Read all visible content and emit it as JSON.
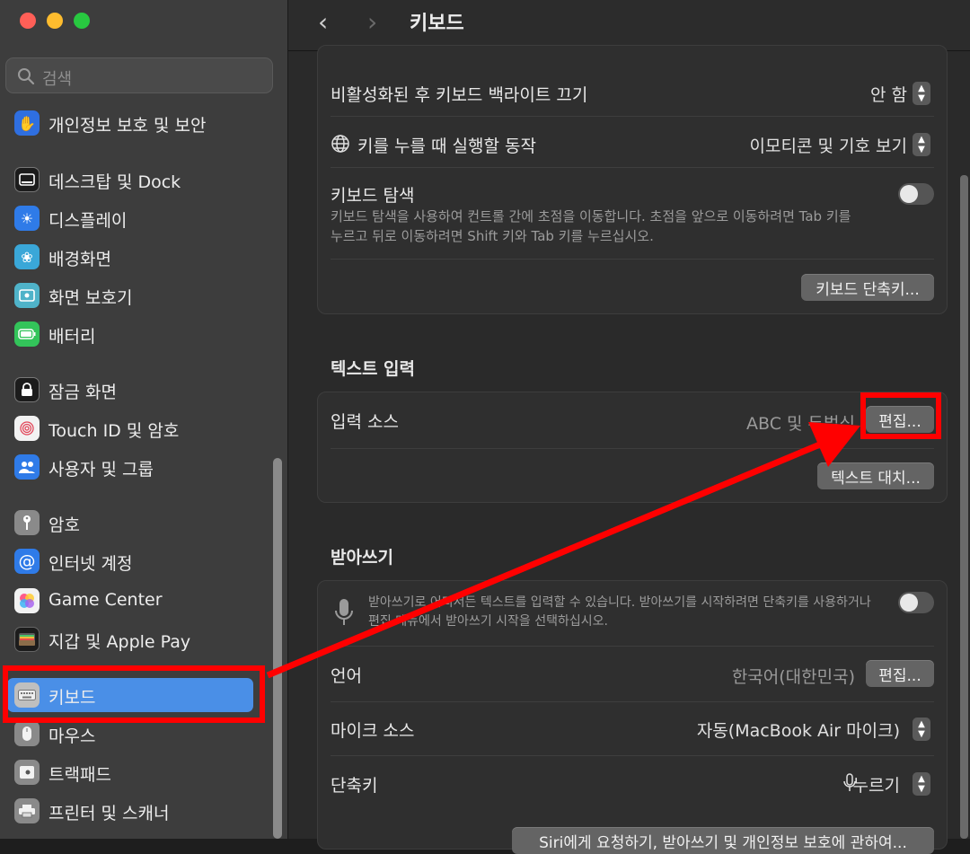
{
  "search": {
    "placeholder": "검색"
  },
  "sidebar": {
    "items": [
      {
        "label": "개인정보 보호 및 보안",
        "icon": "hand-icon",
        "color": "#2f6fe0"
      },
      {
        "label": "데스크탑 및 Dock",
        "icon": "dock-icon",
        "color": "#1c1c1c"
      },
      {
        "label": "디스플레이",
        "icon": "sun-icon",
        "color": "#2f7be8"
      },
      {
        "label": "배경화면",
        "icon": "flower-icon",
        "color": "#3aa7d8"
      },
      {
        "label": "화면 보호기",
        "icon": "screensaver-icon",
        "color": "#4fb3c9"
      },
      {
        "label": "배터리",
        "icon": "battery-icon",
        "color": "#33c45a"
      },
      {
        "label": "잠금 화면",
        "icon": "lock-icon",
        "color": "#1c1c1c"
      },
      {
        "label": "Touch ID 및 암호",
        "icon": "fingerprint-icon",
        "color": "#f2f2f2"
      },
      {
        "label": "사용자 및 그룹",
        "icon": "users-icon",
        "color": "#2f7be8"
      },
      {
        "label": "암호",
        "icon": "key-icon",
        "color": "#8a8a8a"
      },
      {
        "label": "인터넷 계정",
        "icon": "at-icon",
        "color": "#2f7be8"
      },
      {
        "label": "Game Center",
        "icon": "game-center-icon",
        "color": "#f2f2f2"
      },
      {
        "label": "지갑 및 Apple Pay",
        "icon": "wallet-icon",
        "color": "#1c1c1c"
      },
      {
        "label": "키보드",
        "icon": "keyboard-icon",
        "color": "#9a9a9a"
      },
      {
        "label": "마우스",
        "icon": "mouse-icon",
        "color": "#8a8a8a"
      },
      {
        "label": "트랙패드",
        "icon": "trackpad-icon",
        "color": "#8a8a8a"
      },
      {
        "label": "프린터 및 스캐너",
        "icon": "printer-icon",
        "color": "#8a8a8a"
      }
    ]
  },
  "header": {
    "title": "키보드",
    "back": "‹",
    "forward": "›"
  },
  "keyboard": {
    "backlight_label": "비활성화된 후 키보드 백라이트 끄기",
    "backlight_value": "안 함",
    "globe_label": "키를 누를 때 실행할 동작",
    "globe_value": "이모티콘 및 기호 보기",
    "navigation_label": "키보드 탐색",
    "navigation_desc1": "키보드 탐색을 사용하여 컨트롤 간에 초점을 이동합니다. 초점을 앞으로 이동하려면 Tab 키를",
    "navigation_desc2": "누르고 뒤로 이동하려면 Shift 키와 Tab 키를 누르십시오.",
    "shortcuts_button": "키보드 단축키..."
  },
  "text_input": {
    "section_title": "텍스트 입력",
    "input_sources_label": "입력 소스",
    "input_sources_value": "ABC 및 두벌식",
    "edit_button": "편집...",
    "text_replace_button": "텍스트 대치..."
  },
  "dictation": {
    "section_title": "받아쓰기",
    "desc1": "받아쓰기로 어디서든 텍스트를 입력할 수 있습니다. 받아쓰기를 시작하려면 단축키를 사용하거나",
    "desc2": "편집 메뉴에서 받아쓰기 시작을 선택하십시오.",
    "language_label": "언어",
    "language_value": "한국어(대한민국)",
    "language_edit": "편집...",
    "mic_label": "마이크 소스",
    "mic_value": "자동(MacBook Air 마이크)",
    "shortcut_label": "단축키",
    "shortcut_value": "누르기",
    "siri_button": "Siri에게 요청하기, 받아쓰기 및 개인정보 보호에 관하여..."
  },
  "colors": {
    "accent": "#4a8fe7",
    "highlight": "#ff0000"
  }
}
